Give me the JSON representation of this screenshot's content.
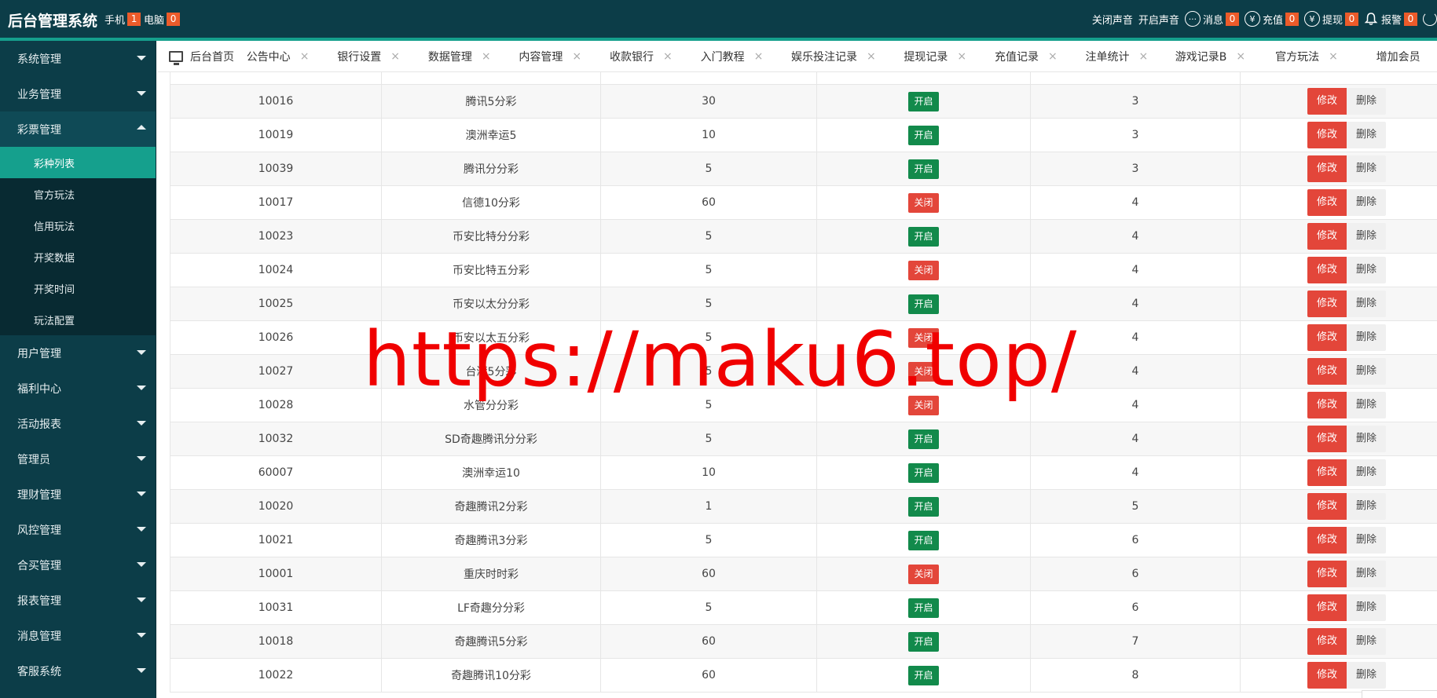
{
  "header": {
    "brand": "后台管理系统",
    "stats": [
      {
        "label": "手机",
        "count": "1"
      },
      {
        "label": "电脑",
        "count": "0"
      }
    ],
    "right": {
      "sound_off": "关闭声音",
      "sound_on": "开启声音",
      "messages": {
        "label": "消息",
        "count": "0"
      },
      "recharge": {
        "label": "充值",
        "count": "0"
      },
      "withdraw": {
        "label": "提现",
        "count": "0"
      },
      "alarm": {
        "label": "报警",
        "count": "0"
      }
    },
    "colors": {
      "bg": "#0c3d48",
      "accent": "#15a08d",
      "badge": "#ec5b2a"
    }
  },
  "sidebar": {
    "items_before": [
      "系统管理",
      "业务管理"
    ],
    "open_item": "彩票管理",
    "sub_items": [
      "彩种列表",
      "官方玩法",
      "信用玩法",
      "开奖数据",
      "开奖时间",
      "玩法配置"
    ],
    "active_sub": "彩种列表",
    "items_after": [
      "用户管理",
      "福利中心",
      "活动报表",
      "管理员",
      "理财管理",
      "风控管理",
      "合买管理",
      "报表管理",
      "消息管理",
      "客服系统"
    ]
  },
  "tabs": {
    "home": "后台首页",
    "items": [
      "公告中心",
      "银行设置",
      "数据管理",
      "内容管理",
      "收款银行",
      "入门教程",
      "娱乐投注记录",
      "提现记录",
      "充值记录",
      "注单统计",
      "游戏记录B",
      "官方玩法",
      "增加会员"
    ],
    "close_glyph": "×"
  },
  "table": {
    "status_labels": {
      "on": "开启",
      "off": "关闭"
    },
    "edit_label": "修改",
    "delete_label": "删除",
    "rows": [
      {
        "id": "10016",
        "name": "腾讯5分彩",
        "interval": "30",
        "status": "on",
        "sort": "3"
      },
      {
        "id": "10019",
        "name": "澳洲幸运5",
        "interval": "10",
        "status": "on",
        "sort": "3"
      },
      {
        "id": "10039",
        "name": "腾讯分分彩",
        "interval": "5",
        "status": "on",
        "sort": "3"
      },
      {
        "id": "10017",
        "name": "信德10分彩",
        "interval": "60",
        "status": "off",
        "sort": "4"
      },
      {
        "id": "10023",
        "name": "币安比特分分彩",
        "interval": "5",
        "status": "on",
        "sort": "4"
      },
      {
        "id": "10024",
        "name": "币安比特五分彩",
        "interval": "5",
        "status": "off",
        "sort": "4"
      },
      {
        "id": "10025",
        "name": "币安以太分分彩",
        "interval": "5",
        "status": "on",
        "sort": "4"
      },
      {
        "id": "10026",
        "name": "币安以太五分彩",
        "interval": "5",
        "status": "off",
        "sort": "4"
      },
      {
        "id": "10027",
        "name": "台湾5分彩",
        "interval": "5",
        "status": "off",
        "sort": "4"
      },
      {
        "id": "10028",
        "name": "水管分分彩",
        "interval": "5",
        "status": "off",
        "sort": "4"
      },
      {
        "id": "10032",
        "name": "SD奇趣腾讯分分彩",
        "interval": "5",
        "status": "on",
        "sort": "4"
      },
      {
        "id": "60007",
        "name": "澳洲幸运10",
        "interval": "10",
        "status": "on",
        "sort": "4"
      },
      {
        "id": "10020",
        "name": "奇趣腾讯2分彩",
        "interval": "1",
        "status": "on",
        "sort": "5"
      },
      {
        "id": "10021",
        "name": "奇趣腾讯3分彩",
        "interval": "5",
        "status": "on",
        "sort": "6"
      },
      {
        "id": "10001",
        "name": "重庆时时彩",
        "interval": "60",
        "status": "off",
        "sort": "6"
      },
      {
        "id": "10031",
        "name": "LF奇趣分分彩",
        "interval": "5",
        "status": "on",
        "sort": "6"
      },
      {
        "id": "10018",
        "name": "奇趣腾讯5分彩",
        "interval": "60",
        "status": "on",
        "sort": "7"
      },
      {
        "id": "10022",
        "name": "奇趣腾讯10分彩",
        "interval": "60",
        "status": "on",
        "sort": "8"
      }
    ]
  },
  "watermark": "https://maku6.top/"
}
